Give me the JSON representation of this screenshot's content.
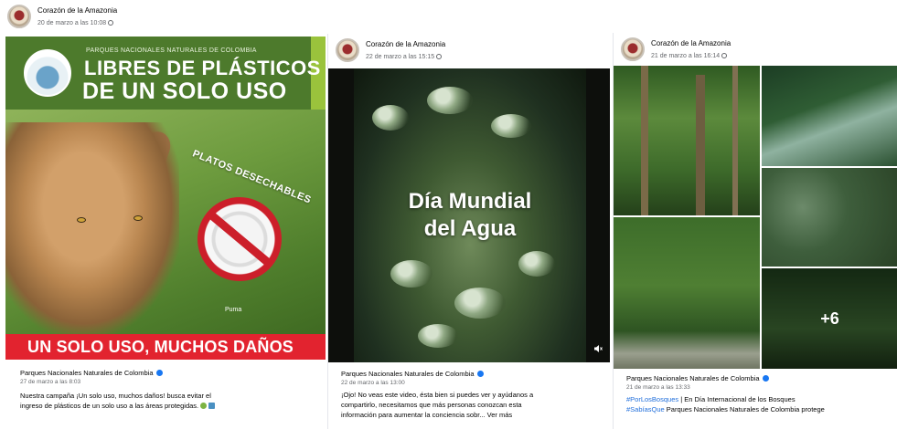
{
  "posts": [
    {
      "page_name": "Corazón de la Amazonia",
      "date": "20 de marzo a las 10:08",
      "image": {
        "org_line": "PARQUES NACIONALES NATURALES DE COLOMBIA",
        "headline_1": "LIBRES DE PLÁSTICOS",
        "headline_2": "DE UN SOLO USO",
        "item_label": "PLATOS DESECHABLES",
        "brand_small": "Puma",
        "bottom_banner": "UN SOLO USO, MUCHOS DAÑOS"
      },
      "shared_from": {
        "name": "Parques Nacionales Naturales de Colombia",
        "date": "27 de marzo a las 8:03",
        "text_1": "Nuestra campaña ¡Un solo uso, muchos daños! busca evitar el",
        "text_2": "ingreso de plásticos de un solo uso a las áreas protegidas."
      }
    },
    {
      "page_name": "Corazón de la Amazonia",
      "date": "22 de marzo a las 15:15",
      "image": {
        "title_1": "Día Mundial",
        "title_2": "del Agua"
      },
      "shared_from": {
        "name": "Parques Nacionales Naturales de Colombia",
        "date": "22 de marzo a las 13:00",
        "text_1": "¡Ojo! No veas este video, ésta bien si puedes ver y ayúdanos a",
        "text_2": "compartirlo, necesitamos que más personas conozcan esta",
        "text_3": "información para aumentar la conciencia sobr... Ver más"
      }
    },
    {
      "page_name": "Corazón de la Amazonia",
      "date": "21 de marzo a las 16:14",
      "image": {
        "more_count": "+6"
      },
      "shared_from": {
        "name": "Parques Nacionales Naturales de Colombia",
        "date": "21 de marzo a las 13:33",
        "hashtag_1": "#PorLosBosques",
        "text_1": " | En Día Internacional de los Bosques",
        "hashtag_2": "#SabíasQue",
        "text_2": " Parques Nacionales Naturales de Colombia protege"
      }
    }
  ],
  "colors": {
    "fb_blue": "#1877f2",
    "banner_green": "#4d7a2c",
    "banner_red": "#e2232f",
    "hashtag": "#216fdb"
  }
}
